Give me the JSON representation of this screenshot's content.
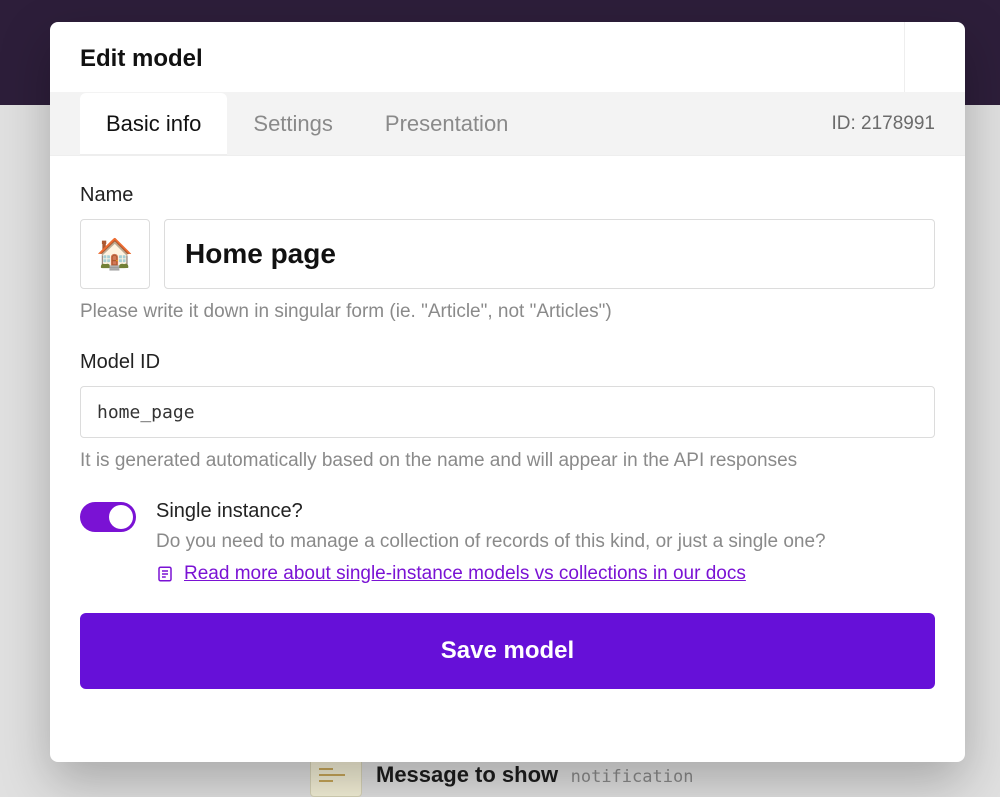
{
  "behind": {
    "title": "Message to show",
    "slug": "notification"
  },
  "modal": {
    "title": "Edit model",
    "id_label": "ID: 2178991",
    "tabs": [
      {
        "label": "Basic info",
        "active": true
      },
      {
        "label": "Settings",
        "active": false
      },
      {
        "label": "Presentation",
        "active": false
      }
    ],
    "name": {
      "label": "Name",
      "icon": "🏠",
      "value": "Home page",
      "helper": "Please write it down in singular form (ie. \"Article\", not \"Articles\")"
    },
    "model_id": {
      "label": "Model ID",
      "value": "home_page",
      "helper": "It is generated automatically based on the name and will appear in the API responses"
    },
    "single_instance": {
      "label": "Single instance?",
      "enabled": true,
      "description": "Do you need to manage a collection of records of this kind, or just a single one?",
      "link_text": "Read more about single-instance models vs collections in our docs"
    },
    "save_label": "Save model"
  },
  "colors": {
    "accent": "#7a12d4",
    "primary_button": "#6610d8"
  }
}
